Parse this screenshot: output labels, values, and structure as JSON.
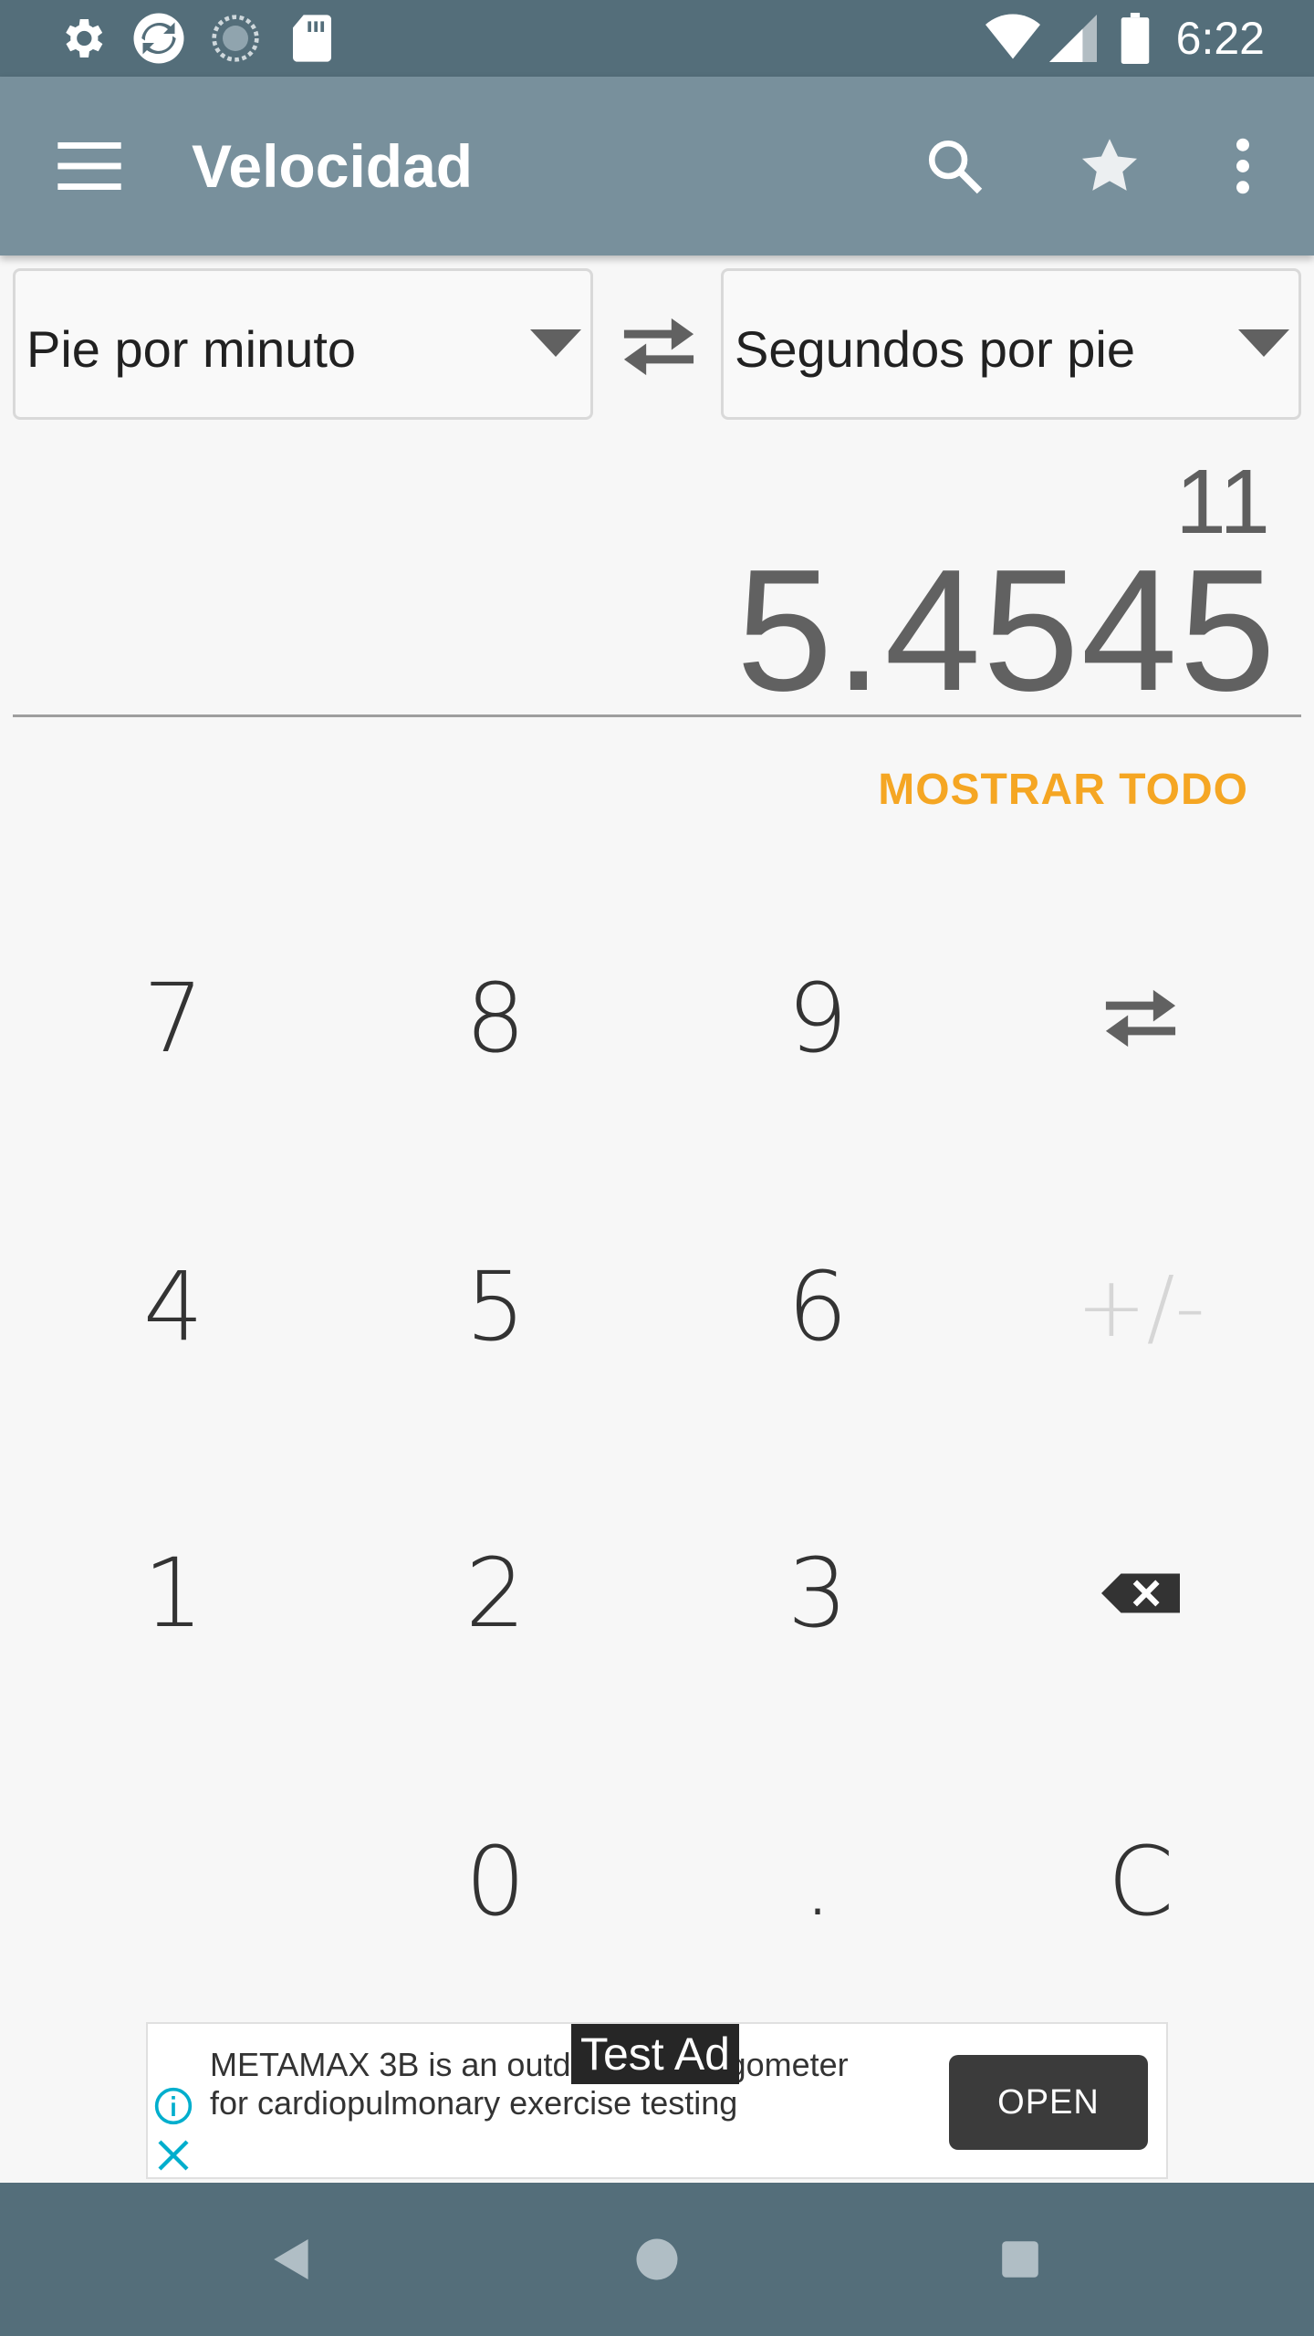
{
  "status_bar": {
    "time": "6:22",
    "icons": [
      "settings-icon",
      "sync-app-icon",
      "loading-app-icon",
      "sd-card-icon",
      "wifi-icon",
      "signal-icon",
      "battery-icon"
    ]
  },
  "app_bar": {
    "title": "Velocidad",
    "actions": [
      "menu-icon",
      "search-icon",
      "star-icon",
      "more-vert-icon"
    ]
  },
  "converter": {
    "from_unit": "Pie por minuto",
    "to_unit": "Segundos por pie",
    "input_value": "11",
    "result_value": "5.4545",
    "show_all_label": "MOSTRAR TODO"
  },
  "keypad": {
    "k7": "7",
    "k8": "8",
    "k9": "9",
    "k4": "4",
    "k5": "5",
    "k6": "6",
    "plus_minus": "+/-",
    "k1": "1",
    "k2": "2",
    "k3": "3",
    "k0": "0",
    "dot": ".",
    "clear": "C"
  },
  "ad": {
    "text": "METAMAX 3B is an outdoor spiroergometer for cardiopulmonary exercise testing",
    "badge": "Test Ad",
    "cta": "OPEN"
  },
  "colors": {
    "status_bar": "#546e7a",
    "app_bar": "#78909c",
    "accent": "#f5a623",
    "background": "#f7f7f7"
  }
}
